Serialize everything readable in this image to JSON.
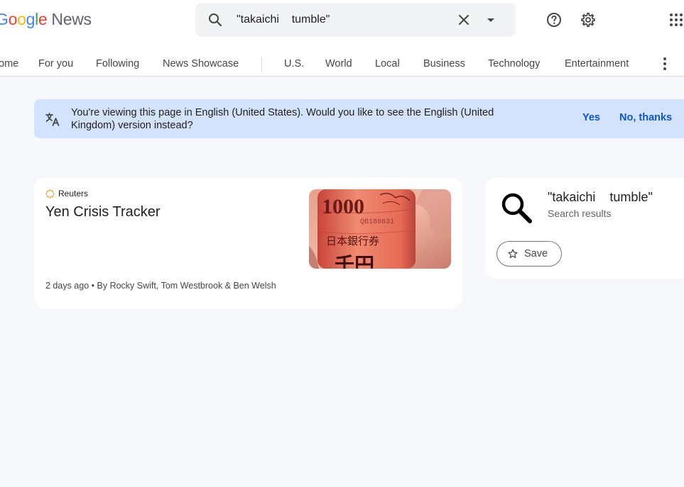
{
  "logo": {
    "google": [
      "G",
      "o",
      "o",
      "g",
      "l",
      "e"
    ],
    "product": "News"
  },
  "search": {
    "query": "\"takaichi    tumble\""
  },
  "nav": {
    "tabs": [
      "ome",
      "For you",
      "Following",
      "News Showcase",
      "U.S.",
      "World",
      "Local",
      "Business",
      "Technology",
      "Entertainment"
    ]
  },
  "banner": {
    "message": "You're viewing this page in English (United States). Would you like to see the English (United Kingdom) version instead?",
    "yes_label": "Yes",
    "no_label": "No, thanks"
  },
  "article": {
    "source": "Reuters",
    "title": "Yen Crisis Tracker",
    "time": "2 days ago",
    "byline": "By Rocky Swift, Tom Westbrook & Ben Welsh",
    "image_text": {
      "denomination": "1000",
      "serial": "QB180631",
      "kanji": "日本銀行券",
      "bottom": "千円"
    }
  },
  "side": {
    "query": "\"takaichi    tumble\"",
    "subtitle": "Search results",
    "save_label": "Save"
  },
  "icons": [
    "search-icon",
    "clear-icon",
    "dropdown-arrow-icon",
    "help-icon",
    "settings-icon",
    "apps-grid-icon",
    "more-vert-icon",
    "translate-icon",
    "star-icon"
  ],
  "colors": {
    "accent": "#0b57d0",
    "banner_bg": "#d3e3fd",
    "page_bg": "#f6f8fc"
  }
}
